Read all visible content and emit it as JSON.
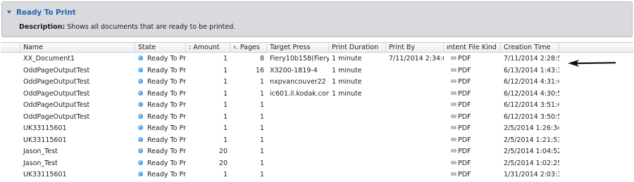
{
  "panel": {
    "title": "Ready To Print",
    "desc_label": "Description:",
    "desc_text": "Shows all documents that are ready to be printed."
  },
  "columns": [
    "Name",
    "State",
    ": Amount",
    "›. Pages",
    "Target Press",
    "Print Duration",
    "Print By",
    "ıntent File Kind",
    "Creation Time"
  ],
  "rows": [
    {
      "name": "XX_Document1",
      "state": "Ready To Prir",
      "amount": "1",
      "pages": "8",
      "press": "Fiery10b158(Fiery:",
      "duration": "1 minute",
      "print_by": "7/11/2014 2:34:0!",
      "kind": "PDF",
      "created": "7/11/2014 2:28:5:"
    },
    {
      "name": "OddPageOutputTest",
      "state": "Ready To Prir",
      "amount": "1",
      "pages": "16",
      "press": "X3200-1819-4",
      "duration": "1 minute",
      "print_by": "",
      "kind": "PDF",
      "created": "6/13/2014 1:43:3("
    },
    {
      "name": "OddPageOutputTest",
      "state": "Ready To Prir",
      "amount": "1",
      "pages": "1",
      "press": "nxpvancouver22",
      "duration": "1 minute",
      "print_by": "",
      "kind": "PDF",
      "created": "6/12/2014 4:31:4("
    },
    {
      "name": "OddPageOutputTest",
      "state": "Ready To Prir",
      "amount": "1",
      "pages": "1",
      "press": "ic601.il.kodak.com",
      "duration": "1 minute",
      "print_by": "",
      "kind": "PDF",
      "created": "6/12/2014 4:30:5("
    },
    {
      "name": "OddPageOutputTest",
      "state": "Ready To Prir",
      "amount": "1",
      "pages": "1",
      "press": "",
      "duration": "",
      "print_by": "",
      "kind": "PDF",
      "created": "6/12/2014 3:51:4!"
    },
    {
      "name": "OddPageOutputTest",
      "state": "Ready To Prir",
      "amount": "1",
      "pages": "1",
      "press": "",
      "duration": "",
      "print_by": "",
      "kind": "PDF",
      "created": "6/12/2014 3:50:5:"
    },
    {
      "name": "UK33115601",
      "state": "Ready To Prir",
      "amount": "1",
      "pages": "1",
      "press": "",
      "duration": "",
      "print_by": "",
      "kind": "PDF",
      "created": "2/5/2014 1:26:34"
    },
    {
      "name": "UK33115601",
      "state": "Ready To Prir",
      "amount": "1",
      "pages": "1",
      "press": "",
      "duration": "",
      "print_by": "",
      "kind": "PDF",
      "created": "2/5/2014 1:21:53"
    },
    {
      "name": "Jason_Test",
      "state": "Ready To Prir",
      "amount": "20",
      "pages": "1",
      "press": "",
      "duration": "",
      "print_by": "",
      "kind": "PDF",
      "created": "2/5/2014 1:04:52"
    },
    {
      "name": "Jason_Test",
      "state": "Ready To Prir",
      "amount": "20",
      "pages": "1",
      "press": "",
      "duration": "",
      "print_by": "",
      "kind": "PDF",
      "created": "2/5/2014 1:02:25"
    },
    {
      "name": "UK33115601",
      "state": "Ready To Prir",
      "amount": "1",
      "pages": "1",
      "press": "",
      "duration": "",
      "print_by": "",
      "kind": "PDF",
      "created": "1/31/2014 2:03:31"
    }
  ],
  "colors": {
    "accent": "#2468b4",
    "state_dot": "#1f80d8",
    "panel_bg": "#d9dadd"
  },
  "icons": {
    "collapse": "triangle-down-icon",
    "state": "status-dot-icon",
    "kind": "pdf-icon",
    "pointer": "arrow-icon"
  }
}
